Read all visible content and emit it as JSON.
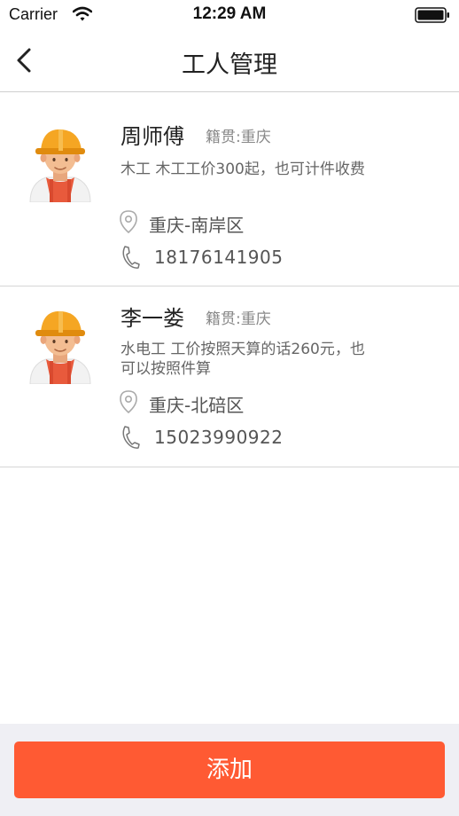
{
  "status_bar": {
    "carrier": "Carrier",
    "time": "12:29 AM"
  },
  "nav": {
    "title": "工人管理"
  },
  "workers": [
    {
      "name": "周师傅",
      "origin": "籍贯:重庆",
      "description": "木工 木工工价300起，也可计件收费",
      "location": "重庆-南岸区",
      "phone": "18176141905"
    },
    {
      "name": "李一娄",
      "origin": "籍贯:重庆",
      "description": "水电工 工价按照天算的话260元，也可以按照件算",
      "location": "重庆-北碚区",
      "phone": "15023990922"
    }
  ],
  "footer": {
    "add_label": "添加"
  },
  "colors": {
    "accent": "#ff5a33",
    "helmet": "#f5a623"
  }
}
